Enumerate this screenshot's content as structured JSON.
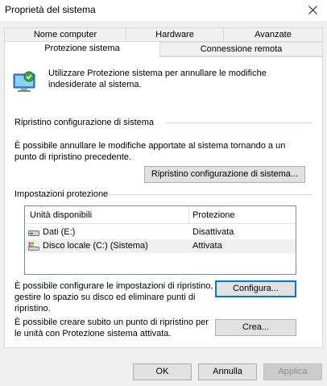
{
  "window": {
    "title": "Proprietà del sistema"
  },
  "tabs": {
    "row1": [
      "Nome computer",
      "Hardware",
      "Avanzate"
    ],
    "row2": [
      "Protezione sistema",
      "Connessione remota"
    ],
    "active": "Protezione sistema"
  },
  "intro": {
    "text": "Utilizzare Protezione sistema per annullare le modifiche indesiderate al sistema."
  },
  "restore": {
    "heading": "Ripristino configurazione di sistema",
    "description": "È possibile annullare le modifiche apportate al sistema tornando a un punto di ripristino precedente.",
    "button": "Ripristino configurazione di sistema..."
  },
  "protection": {
    "heading": "Impostazioni protezione",
    "columns": [
      "Unità disponibili",
      "Protezione"
    ],
    "rows": [
      {
        "drive": "Dati (E:)",
        "status": "Disattivata",
        "icon": "hard-drive-icon"
      },
      {
        "drive": "Disco locale (C:) (Sistema)",
        "status": "Attivata",
        "icon": "system-drive-icon"
      }
    ],
    "configure_text": "È possibile configurare le impostazioni di ripristino, gestire lo spazio su disco ed eliminare punti di ripristino.",
    "configure_button": "Configura...",
    "create_text": "È possibile creare subito un punto di ripristino per le unità con Protezione sistema attivata.",
    "create_button": "Crea..."
  },
  "footer": {
    "ok": "OK",
    "cancel": "Annulla",
    "apply": "Applica"
  },
  "colors": {
    "focus": "#0078d7",
    "selected_row": "#f0f0f0"
  }
}
